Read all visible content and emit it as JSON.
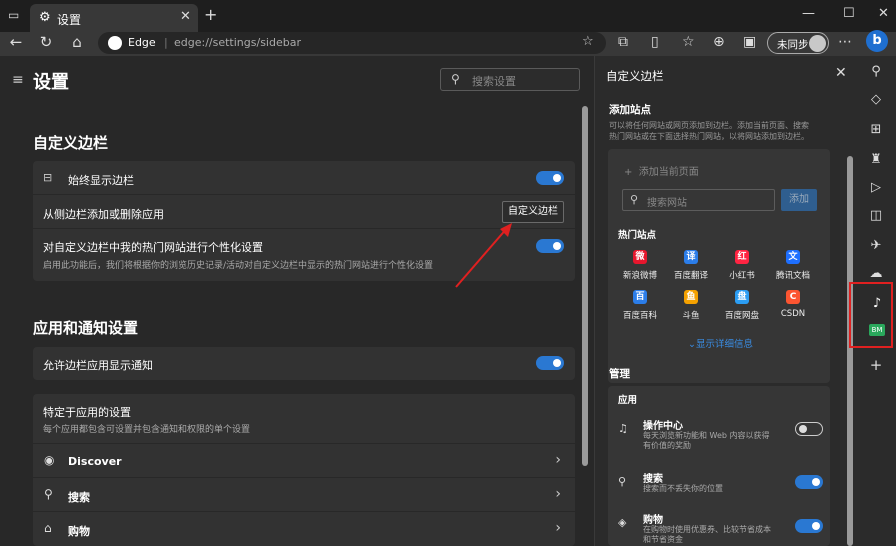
{
  "window": {
    "tab_title": "设置",
    "tab_icon": "gear-icon",
    "new_tab": "+",
    "controls": [
      "—",
      "☐",
      "✕"
    ]
  },
  "address_bar": {
    "browser_name": "Edge",
    "separator": "|",
    "url": "edge://settings/sidebar",
    "sync_label": "未同步"
  },
  "settings": {
    "title": "设置",
    "search_placeholder": "搜索设置",
    "custom_sidebar": {
      "title": "自定义边栏",
      "always_show": "始终显示边栏",
      "add_remove": "从侧边栏添加或删除应用",
      "customize_button": "自定义边栏",
      "personalize": "对自定义边栏中我的热门网站进行个性化设置",
      "personalize_desc": "启用此功能后，我们将根据你的浏览历史记录/活动对自定义边栏中显示的热门网站进行个性化设置"
    },
    "app_notifications": {
      "title": "应用和通知设置",
      "allow_notify": "允许边栏应用显示通知",
      "app_specific": "特定于应用的设置",
      "app_specific_desc": "每个应用都包含可设置并包含通知和权限的单个设置",
      "apps": [
        {
          "name": "Discover",
          "icon": "discover-icon"
        },
        {
          "name": "搜索",
          "icon": "search-icon"
        },
        {
          "name": "购物",
          "icon": "tag-icon"
        }
      ]
    }
  },
  "panel": {
    "title": "自定义边栏",
    "add_site_title": "添加站点",
    "add_site_desc": "可以将任何网站或网页添加到边栏。添加当前页面、搜索热门网站或在下面选择热门网站，以将网站添加到边栏。",
    "add_current": "添加当前页面",
    "search_placeholder": "搜索网站",
    "add_button": "添加",
    "hot_title": "热门站点",
    "sites": [
      {
        "name": "新浪微博",
        "color": "#e6162d",
        "glyph": "微"
      },
      {
        "name": "百度翻译",
        "color": "#2b7de9",
        "glyph": "译"
      },
      {
        "name": "小红书",
        "color": "#ff2442",
        "glyph": "红"
      },
      {
        "name": "腾讯文档",
        "color": "#1e6fff",
        "glyph": "文"
      },
      {
        "name": "百度百科",
        "color": "#2b7de9",
        "glyph": "百"
      },
      {
        "name": "斗鱼",
        "color": "#f4a100",
        "glyph": "鱼"
      },
      {
        "name": "百度网盘",
        "color": "#2b9df3",
        "glyph": "盘"
      },
      {
        "name": "CSDN",
        "color": "#fc5531",
        "glyph": "C"
      }
    ],
    "show_more": "显示详细信息",
    "manage_title": "管理",
    "apps_title": "应用",
    "apps": [
      {
        "name": "操作中心",
        "desc": "每天浏览新功能和 Web 内容以获得有价值的奖励",
        "icon": "bell-icon",
        "on": false
      },
      {
        "name": "搜索",
        "desc": "搜索而不丢失你的位置",
        "icon": "search-icon",
        "on": true
      },
      {
        "name": "购物",
        "desc": "在购物时使用优惠券、比较节省成本和节省资金",
        "icon": "tag-icon",
        "on": true
      }
    ]
  },
  "strip": {
    "tiktok_glyph": "♪",
    "bm_label": "BM",
    "add_label": "+"
  },
  "accent_color": "#2a78d2",
  "highlight_color": "#e02020"
}
